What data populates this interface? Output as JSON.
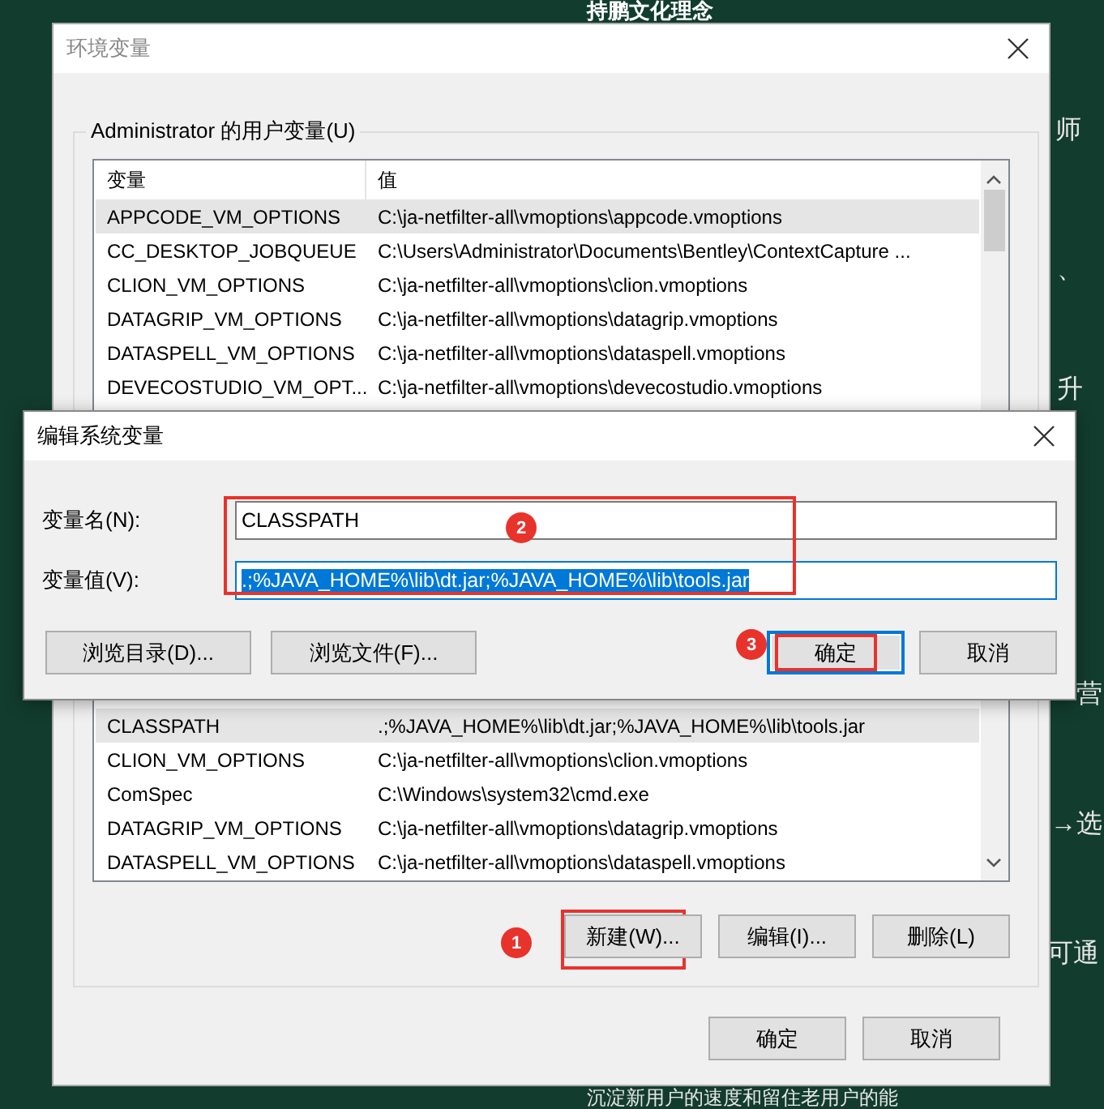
{
  "background": {
    "title": "持鹏文化理念",
    "fragments": [
      {
        "text": "师"
      },
      {
        "text": "、"
      },
      {
        "text": "升"
      },
      {
        "text": "营"
      },
      {
        "text": "→选"
      },
      {
        "text": "可通"
      }
    ],
    "footer": "沉淀新用户的速度和留住老用户的能"
  },
  "env_window": {
    "title": "环境变量",
    "group_label": "Administrator 的用户变量(U)",
    "columns": [
      "变量",
      "值"
    ],
    "user_rows": [
      {
        "name": "APPCODE_VM_OPTIONS",
        "value": "C:\\ja-netfilter-all\\vmoptions\\appcode.vmoptions",
        "selected": true
      },
      {
        "name": "CC_DESKTOP_JOBQUEUE",
        "value": "C:\\Users\\Administrator\\Documents\\Bentley\\ContextCapture ...",
        "selected": false
      },
      {
        "name": "CLION_VM_OPTIONS",
        "value": "C:\\ja-netfilter-all\\vmoptions\\clion.vmoptions",
        "selected": false
      },
      {
        "name": "DATAGRIP_VM_OPTIONS",
        "value": "C:\\ja-netfilter-all\\vmoptions\\datagrip.vmoptions",
        "selected": false
      },
      {
        "name": "DATASPELL_VM_OPTIONS",
        "value": "C:\\ja-netfilter-all\\vmoptions\\dataspell.vmoptions",
        "selected": false
      },
      {
        "name": "DEVECOSTUDIO_VM_OPT...",
        "value": "C:\\ja-netfilter-all\\vmoptions\\devecostudio.vmoptions",
        "selected": false
      }
    ],
    "system_rows": [
      {
        "name": "CLASSPATH",
        "value": ".;%JAVA_HOME%\\lib\\dt.jar;%JAVA_HOME%\\lib\\tools.jar",
        "selected": true
      },
      {
        "name": "CLION_VM_OPTIONS",
        "value": "C:\\ja-netfilter-all\\vmoptions\\clion.vmoptions",
        "selected": false
      },
      {
        "name": "ComSpec",
        "value": "C:\\Windows\\system32\\cmd.exe",
        "selected": false
      },
      {
        "name": "DATAGRIP_VM_OPTIONS",
        "value": "C:\\ja-netfilter-all\\vmoptions\\datagrip.vmoptions",
        "selected": false
      },
      {
        "name": "DATASPELL_VM_OPTIONS",
        "value": "C:\\ja-netfilter-all\\vmoptions\\dataspell.vmoptions",
        "selected": false
      }
    ],
    "system_buttons": [
      {
        "label": "新建(W)...",
        "callout": "1"
      },
      {
        "label": "编辑(I)..."
      },
      {
        "label": "删除(L)"
      }
    ],
    "buttons": [
      "确定",
      "取消"
    ]
  },
  "edit_window": {
    "title": "编辑系统变量",
    "fields_callout": "2",
    "fields": [
      {
        "label": "变量名(N):",
        "value": "CLASSPATH",
        "text_selected": false
      },
      {
        "label": "变量值(V):",
        "value": ".;%JAVA_HOME%\\lib\\dt.jar;%JAVA_HOME%\\lib\\tools.jar",
        "text_selected": true
      }
    ],
    "buttons": [
      {
        "label": "浏览目录(D)...",
        "kind": "plain"
      },
      {
        "label": "浏览文件(F)...",
        "kind": "plain"
      },
      {
        "label": "确定",
        "kind": "default",
        "callout": "3"
      },
      {
        "label": "取消",
        "kind": "plain"
      }
    ]
  }
}
